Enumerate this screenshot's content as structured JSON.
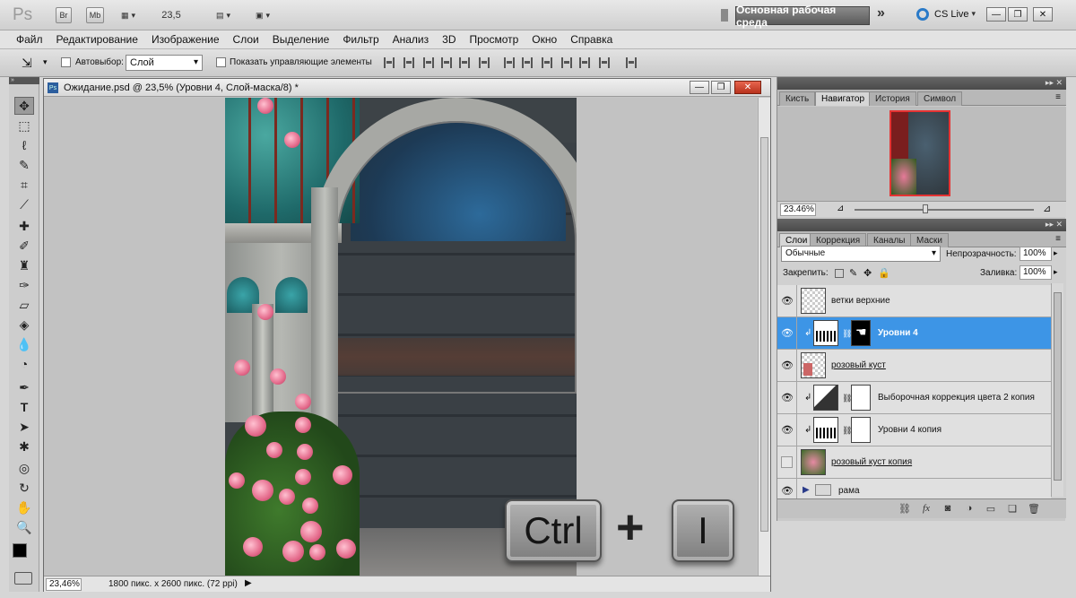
{
  "app": {
    "logo": "Ps",
    "br": "Br",
    "mb": "Mb",
    "zoom": "23,5",
    "workspace": "Основная рабочая среда",
    "chevrons": "»",
    "cslive": "CS Live"
  },
  "menu": [
    "Файл",
    "Редактирование",
    "Изображение",
    "Слои",
    "Выделение",
    "Фильтр",
    "Анализ",
    "3D",
    "Просмотр",
    "Окно",
    "Справка"
  ],
  "options": {
    "autoselect_label": "Автовыбор:",
    "autoselect_value": "Слой",
    "show_controls_label": "Показать управляющие элементы"
  },
  "document": {
    "title": "Ожидание.psd @ 23,5% (Уровни 4, Слой-маска/8) *",
    "zoom": "23,46%",
    "info": "1800 пикс. x 2600 пикс. (72 ppi)"
  },
  "overlay": {
    "key1": "Ctrl",
    "plus": "+",
    "key2": "I"
  },
  "navigator": {
    "tabs": [
      "Кисть",
      "Навигатор",
      "История",
      "Символ"
    ],
    "zoom": "23.46%",
    "zoom_level": 0.38
  },
  "layers": {
    "tabs": [
      "Слои",
      "Коррекция",
      "Каналы",
      "Маски"
    ],
    "blend_mode": "Обычные",
    "opacity_label": "Непрозрачность:",
    "opacity": "100%",
    "lock_label": "Закрепить:",
    "fill_label": "Заливка:",
    "fill": "100%",
    "items": [
      {
        "name": "ветки верхние",
        "visible": true,
        "selected": false
      },
      {
        "name": "Уровни 4",
        "visible": true,
        "selected": true
      },
      {
        "name": "розовый куст",
        "visible": true,
        "selected": false
      },
      {
        "name": "Выборочная коррекция цвета 2 копия",
        "visible": true,
        "selected": false
      },
      {
        "name": "Уровни 4 копия",
        "visible": true,
        "selected": false
      },
      {
        "name": "розовый куст копия",
        "visible": false,
        "selected": false
      },
      {
        "name": "рама",
        "visible": true,
        "selected": false
      }
    ]
  },
  "colors": {
    "selection": "#3d95e6",
    "foreground": "#000000",
    "background": "#ffffff"
  }
}
